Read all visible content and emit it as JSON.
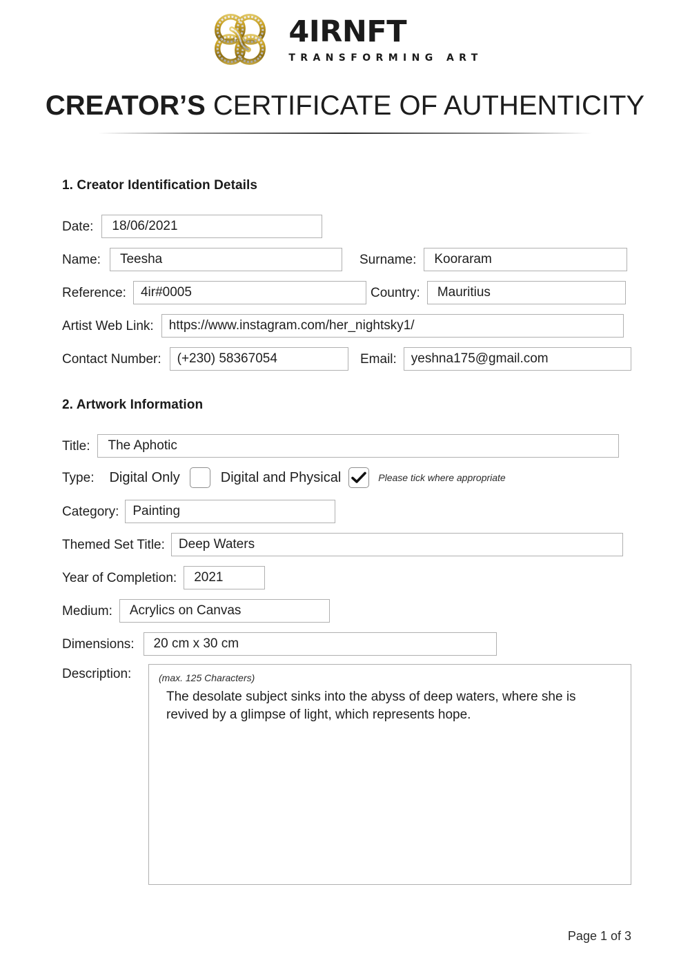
{
  "brand": {
    "logo_icon": "quatrefoil-knot-logo",
    "name": "4IRNFT",
    "tagline": "TRANSFORMING ART",
    "gold": "#C9A227",
    "silver": "#D9D9D9"
  },
  "document": {
    "title_bold": "CREATOR’S",
    "title_rest": " CERTIFICATE OF AUTHENTICITY",
    "footer": "Page 1 of 3"
  },
  "section1": {
    "heading": "1. Creator Identification Details",
    "date": {
      "label": "Date:",
      "value": "18/06/2021"
    },
    "name": {
      "label": "Name:",
      "value": "Teesha"
    },
    "surname": {
      "label": "Surname:",
      "value": "Kooraram"
    },
    "reference": {
      "label": "Reference:",
      "value": "4ir#0005"
    },
    "country": {
      "label": "Country:",
      "value": "Mauritius"
    },
    "web_link": {
      "label": "Artist Web Link:",
      "value": "https://www.instagram.com/her_nightsky1/"
    },
    "contact": {
      "label": "Contact Number:",
      "value": "(+230) 58367054"
    },
    "email": {
      "label": "Email:",
      "value": "yeshna175@gmail.com"
    }
  },
  "section2": {
    "heading": "2. Artwork Information",
    "title": {
      "label": "Title:",
      "value": "The Aphotic"
    },
    "type": {
      "label": "Type:",
      "option_digital_only": "Digital Only",
      "digital_only_checked": false,
      "option_digital_physical": "Digital and Physical",
      "digital_physical_checked": true,
      "hint": "Please tick where appropriate"
    },
    "category": {
      "label": "Category:",
      "value": "Painting"
    },
    "themed_set": {
      "label": "Themed Set Title:",
      "value": "Deep Waters"
    },
    "year": {
      "label": "Year of Completion:",
      "value": "2021"
    },
    "medium": {
      "label": "Medium:",
      "value": "Acrylics on Canvas"
    },
    "dimensions": {
      "label": "Dimensions:",
      "value": "20 cm x 30 cm"
    },
    "description": {
      "label": "Description:",
      "hint": "(max. 125 Characters)",
      "value": "The desolate subject sinks into the abyss of deep waters, where she is revived by a glimpse of light, which represents hope."
    }
  }
}
